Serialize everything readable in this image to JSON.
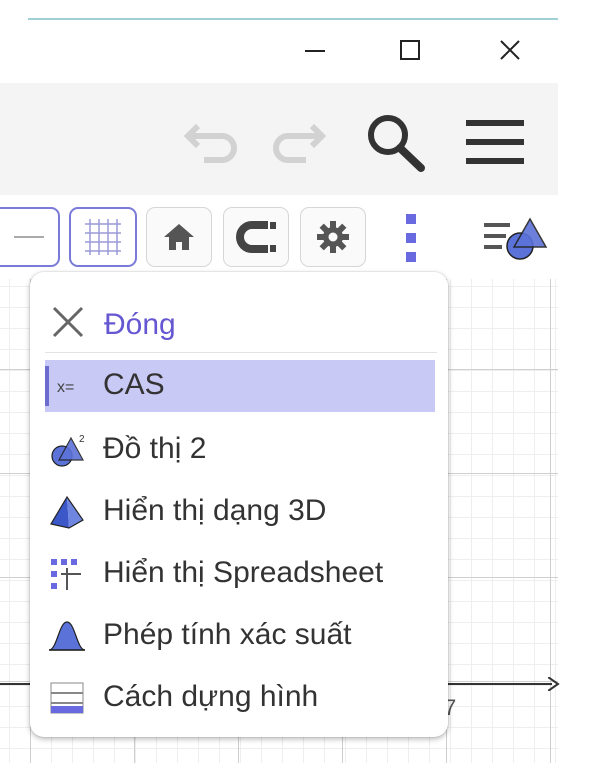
{
  "window": {
    "minimize_icon": "minimize-icon",
    "maximize_icon": "maximize-icon",
    "close_icon": "close-icon"
  },
  "header": {
    "undo_icon": "undo-icon",
    "redo_icon": "redo-icon",
    "search_icon": "search-icon",
    "menu_icon": "hamburger-menu-icon"
  },
  "toolbar": {
    "buttons": [
      "axes-toggle",
      "grid-toggle",
      "home-icon",
      "magnet-icon",
      "gear-icon",
      "more-vertical-icon",
      "algebra-view-icon"
    ],
    "accent_color": "#6557d2"
  },
  "graphics": {
    "axis_label": "7"
  },
  "menu": {
    "close_label": "Đóng",
    "items": [
      {
        "label": "CAS",
        "icon": "cas-icon",
        "highlighted": true
      },
      {
        "label": "Đồ thị 2",
        "icon": "graphics2-icon",
        "highlighted": false
      },
      {
        "label": "Hiển thị dạng 3D",
        "icon": "3d-pyramid-icon",
        "highlighted": false
      },
      {
        "label": "Hiển thị Spreadsheet",
        "icon": "spreadsheet-icon",
        "highlighted": false
      },
      {
        "label": "Phép tính xác suất",
        "icon": "probability-icon",
        "highlighted": false
      },
      {
        "label": "Cách dựng hình",
        "icon": "construction-protocol-icon",
        "highlighted": false
      }
    ],
    "highlight_color": "#c8c9f5"
  }
}
